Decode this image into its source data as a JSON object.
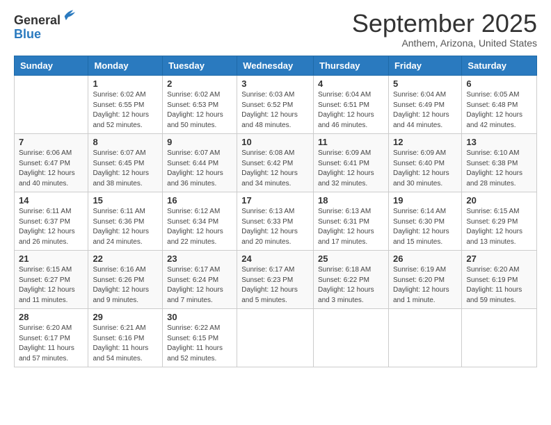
{
  "header": {
    "logo_general": "General",
    "logo_blue": "Blue",
    "month_title": "September 2025",
    "location": "Anthem, Arizona, United States"
  },
  "days_of_week": [
    "Sunday",
    "Monday",
    "Tuesday",
    "Wednesday",
    "Thursday",
    "Friday",
    "Saturday"
  ],
  "weeks": [
    [
      {
        "day": "",
        "info": ""
      },
      {
        "day": "1",
        "info": "Sunrise: 6:02 AM\nSunset: 6:55 PM\nDaylight: 12 hours\nand 52 minutes."
      },
      {
        "day": "2",
        "info": "Sunrise: 6:02 AM\nSunset: 6:53 PM\nDaylight: 12 hours\nand 50 minutes."
      },
      {
        "day": "3",
        "info": "Sunrise: 6:03 AM\nSunset: 6:52 PM\nDaylight: 12 hours\nand 48 minutes."
      },
      {
        "day": "4",
        "info": "Sunrise: 6:04 AM\nSunset: 6:51 PM\nDaylight: 12 hours\nand 46 minutes."
      },
      {
        "day": "5",
        "info": "Sunrise: 6:04 AM\nSunset: 6:49 PM\nDaylight: 12 hours\nand 44 minutes."
      },
      {
        "day": "6",
        "info": "Sunrise: 6:05 AM\nSunset: 6:48 PM\nDaylight: 12 hours\nand 42 minutes."
      }
    ],
    [
      {
        "day": "7",
        "info": "Sunrise: 6:06 AM\nSunset: 6:47 PM\nDaylight: 12 hours\nand 40 minutes."
      },
      {
        "day": "8",
        "info": "Sunrise: 6:07 AM\nSunset: 6:45 PM\nDaylight: 12 hours\nand 38 minutes."
      },
      {
        "day": "9",
        "info": "Sunrise: 6:07 AM\nSunset: 6:44 PM\nDaylight: 12 hours\nand 36 minutes."
      },
      {
        "day": "10",
        "info": "Sunrise: 6:08 AM\nSunset: 6:42 PM\nDaylight: 12 hours\nand 34 minutes."
      },
      {
        "day": "11",
        "info": "Sunrise: 6:09 AM\nSunset: 6:41 PM\nDaylight: 12 hours\nand 32 minutes."
      },
      {
        "day": "12",
        "info": "Sunrise: 6:09 AM\nSunset: 6:40 PM\nDaylight: 12 hours\nand 30 minutes."
      },
      {
        "day": "13",
        "info": "Sunrise: 6:10 AM\nSunset: 6:38 PM\nDaylight: 12 hours\nand 28 minutes."
      }
    ],
    [
      {
        "day": "14",
        "info": "Sunrise: 6:11 AM\nSunset: 6:37 PM\nDaylight: 12 hours\nand 26 minutes."
      },
      {
        "day": "15",
        "info": "Sunrise: 6:11 AM\nSunset: 6:36 PM\nDaylight: 12 hours\nand 24 minutes."
      },
      {
        "day": "16",
        "info": "Sunrise: 6:12 AM\nSunset: 6:34 PM\nDaylight: 12 hours\nand 22 minutes."
      },
      {
        "day": "17",
        "info": "Sunrise: 6:13 AM\nSunset: 6:33 PM\nDaylight: 12 hours\nand 20 minutes."
      },
      {
        "day": "18",
        "info": "Sunrise: 6:13 AM\nSunset: 6:31 PM\nDaylight: 12 hours\nand 17 minutes."
      },
      {
        "day": "19",
        "info": "Sunrise: 6:14 AM\nSunset: 6:30 PM\nDaylight: 12 hours\nand 15 minutes."
      },
      {
        "day": "20",
        "info": "Sunrise: 6:15 AM\nSunset: 6:29 PM\nDaylight: 12 hours\nand 13 minutes."
      }
    ],
    [
      {
        "day": "21",
        "info": "Sunrise: 6:15 AM\nSunset: 6:27 PM\nDaylight: 12 hours\nand 11 minutes."
      },
      {
        "day": "22",
        "info": "Sunrise: 6:16 AM\nSunset: 6:26 PM\nDaylight: 12 hours\nand 9 minutes."
      },
      {
        "day": "23",
        "info": "Sunrise: 6:17 AM\nSunset: 6:24 PM\nDaylight: 12 hours\nand 7 minutes."
      },
      {
        "day": "24",
        "info": "Sunrise: 6:17 AM\nSunset: 6:23 PM\nDaylight: 12 hours\nand 5 minutes."
      },
      {
        "day": "25",
        "info": "Sunrise: 6:18 AM\nSunset: 6:22 PM\nDaylight: 12 hours\nand 3 minutes."
      },
      {
        "day": "26",
        "info": "Sunrise: 6:19 AM\nSunset: 6:20 PM\nDaylight: 12 hours\nand 1 minute."
      },
      {
        "day": "27",
        "info": "Sunrise: 6:20 AM\nSunset: 6:19 PM\nDaylight: 11 hours\nand 59 minutes."
      }
    ],
    [
      {
        "day": "28",
        "info": "Sunrise: 6:20 AM\nSunset: 6:17 PM\nDaylight: 11 hours\nand 57 minutes."
      },
      {
        "day": "29",
        "info": "Sunrise: 6:21 AM\nSunset: 6:16 PM\nDaylight: 11 hours\nand 54 minutes."
      },
      {
        "day": "30",
        "info": "Sunrise: 6:22 AM\nSunset: 6:15 PM\nDaylight: 11 hours\nand 52 minutes."
      },
      {
        "day": "",
        "info": ""
      },
      {
        "day": "",
        "info": ""
      },
      {
        "day": "",
        "info": ""
      },
      {
        "day": "",
        "info": ""
      }
    ]
  ]
}
